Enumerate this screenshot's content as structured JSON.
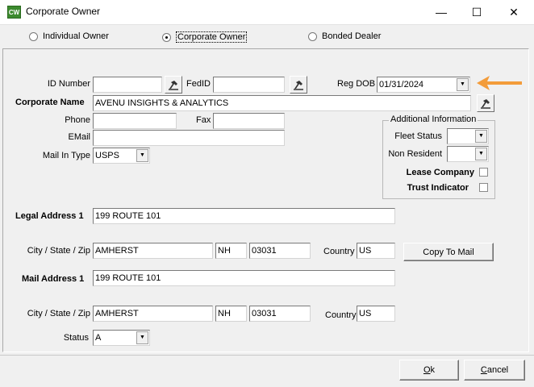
{
  "window": {
    "title": "Corporate Owner",
    "app_icon_text": "CW",
    "minimize": "—",
    "maximize": "☐",
    "close": "✕"
  },
  "owner_type": {
    "options": [
      "Individual Owner",
      "Corporate Owner",
      "Bonded Dealer"
    ],
    "selected": "Corporate Owner"
  },
  "form": {
    "id_number_label": "ID Number",
    "id_number_value": "",
    "fedid_label": "FedID",
    "fedid_value": "",
    "reg_dob_label": "Reg DOB",
    "reg_dob_value": "01/31/2024",
    "corporate_name_label": "Corporate Name",
    "corporate_name_value": "AVENU INSIGHTS & ANALYTICS",
    "phone_label": "Phone",
    "phone_value": "",
    "fax_label": "Fax",
    "fax_value": "",
    "email_label": "EMail",
    "email_value": "",
    "mail_in_type_label": "Mail In Type",
    "mail_in_type_value": "USPS",
    "legal_address_label": "Legal Address 1",
    "legal_address_value": "199 ROUTE 101",
    "legal_csz_label": "City / State / Zip",
    "legal_city": "AMHERST",
    "legal_state": "NH",
    "legal_zip": "03031",
    "legal_country_label": "Country",
    "legal_country": "US",
    "copy_to_mail_label": "Copy To Mail",
    "mail_address_label": "Mail Address 1",
    "mail_address_value": "199 ROUTE 101",
    "mail_csz_label": "City / State / Zip",
    "mail_city": "AMHERST",
    "mail_state": "NH",
    "mail_zip": "03031",
    "mail_country_label": "Country",
    "mail_country": "US",
    "status_label": "Status",
    "status_value": "A"
  },
  "additional_info": {
    "title": "Additional Information",
    "fleet_status_label": "Fleet Status",
    "fleet_status_value": "",
    "non_resident_label": "Non Resident",
    "non_resident_value": "",
    "lease_company_label": "Lease Company",
    "lease_company_checked": false,
    "trust_indicator_label": "Trust Indicator",
    "trust_indicator_checked": false
  },
  "buttons": {
    "ok": "Ok",
    "cancel": "Cancel"
  },
  "icons": {
    "lookup": "lookup-tool-icon",
    "arrow": "orange-pointer-arrow"
  },
  "colors": {
    "accent_arrow": "#f39c3a",
    "app_icon": "#3c8a2e"
  }
}
